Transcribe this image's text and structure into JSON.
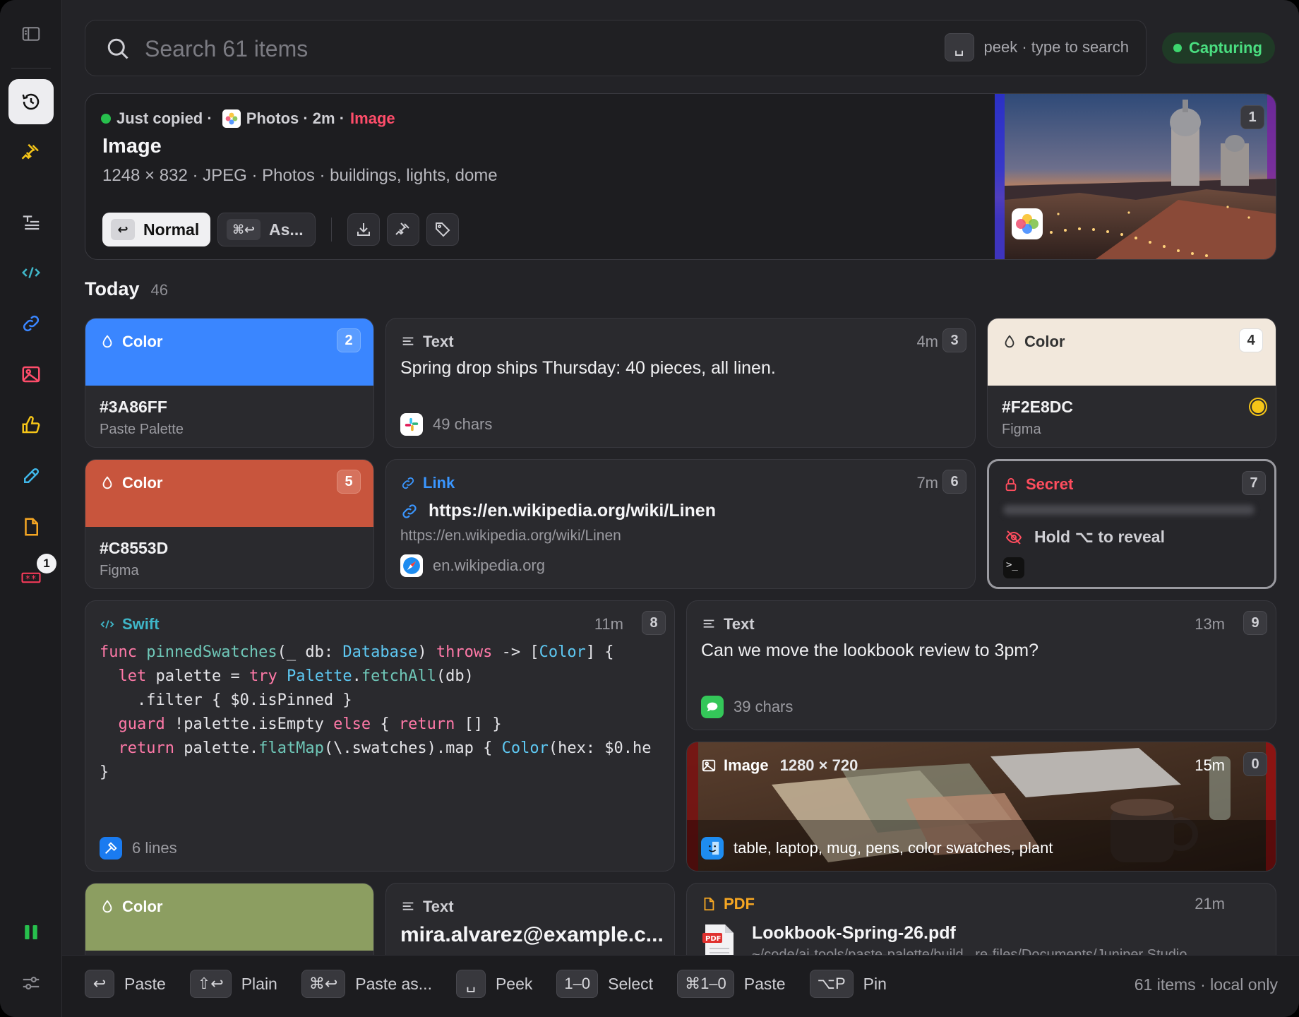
{
  "search": {
    "placeholder": "Search 61 items",
    "hint_key": "␣",
    "hint_text": "peek · type to search"
  },
  "status": {
    "label": "Capturing",
    "color": "#3dd66e"
  },
  "sidebar": {
    "items": [
      "history",
      "pinned",
      "text",
      "code",
      "links",
      "images",
      "likes",
      "colors",
      "files",
      "secrets"
    ],
    "secrets_badge": "1"
  },
  "hero": {
    "state": "Just copied ·",
    "source": "Photos · 2m ·",
    "kind": "Image",
    "title": "Image",
    "subtitle": "1248 × 832 · JPEG · Photos · buildings, lights, dome",
    "normal_key": "↩",
    "normal_label": "Normal",
    "as_key": "⌘↩",
    "as_label": "As...",
    "index": "1"
  },
  "section": {
    "title": "Today",
    "count": "46"
  },
  "cards": {
    "c2": {
      "label": "Color",
      "index": "2",
      "hex": "#3A86FF",
      "source": "Paste Palette",
      "color": "#3A86FF"
    },
    "c3": {
      "label": "Text",
      "time": "4m",
      "index": "3",
      "body": "Spring drop ships Thursday: 40 pieces, all linen.",
      "foot": "49 chars"
    },
    "c4": {
      "label": "Color",
      "index": "4",
      "hex": "#F2E8DC",
      "source": "Figma",
      "color": "#F2E8DC"
    },
    "c5": {
      "label": "Color",
      "index": "5",
      "hex": "#C8553D",
      "source": "Figma",
      "color": "#C8553D"
    },
    "c6": {
      "label": "Link",
      "time": "7m",
      "index": "6",
      "title": "https://en.wikipedia.org/wiki/Linen",
      "url": "https://en.wikipedia.org/wiki/Linen",
      "domain": "en.wikipedia.org"
    },
    "c7": {
      "label": "Secret",
      "index": "7",
      "reveal": "Hold ⌥ to reveal"
    },
    "c8": {
      "label": "Swift",
      "time": "11m",
      "index": "8",
      "foot": "6 lines"
    },
    "c9": {
      "label": "Text",
      "time": "13m",
      "index": "9",
      "body": "Can we move the lookbook review to 3pm?",
      "foot": "39 chars"
    },
    "c0": {
      "label": "Image",
      "dims": "1280 × 720",
      "time": "15m",
      "index": "0",
      "foot": "table, laptop, mug, pens, color swatches, plant"
    },
    "c11": {
      "label": "Color",
      "color": "#8C9E61"
    },
    "c12": {
      "label": "Text",
      "body": "mira.alvarez@example.c..."
    },
    "c13": {
      "label": "PDF",
      "time": "21m",
      "title": "Lookbook-Spring-26.pdf",
      "path": "~/code/ai-tools/paste-palette/build...re-files/Documents/Juniper Studio"
    }
  },
  "footer": {
    "hints": [
      {
        "key": "↩",
        "label": "Paste"
      },
      {
        "key": "⇧↩",
        "label": "Plain"
      },
      {
        "key": "⌘↩",
        "label": "Paste as..."
      },
      {
        "key": "␣",
        "label": "Peek"
      },
      {
        "key": "1–0",
        "label": "Select"
      },
      {
        "key": "⌘1–0",
        "label": "Paste"
      },
      {
        "key": "⌥P",
        "label": "Pin"
      }
    ],
    "summary": "61 items · local only"
  }
}
